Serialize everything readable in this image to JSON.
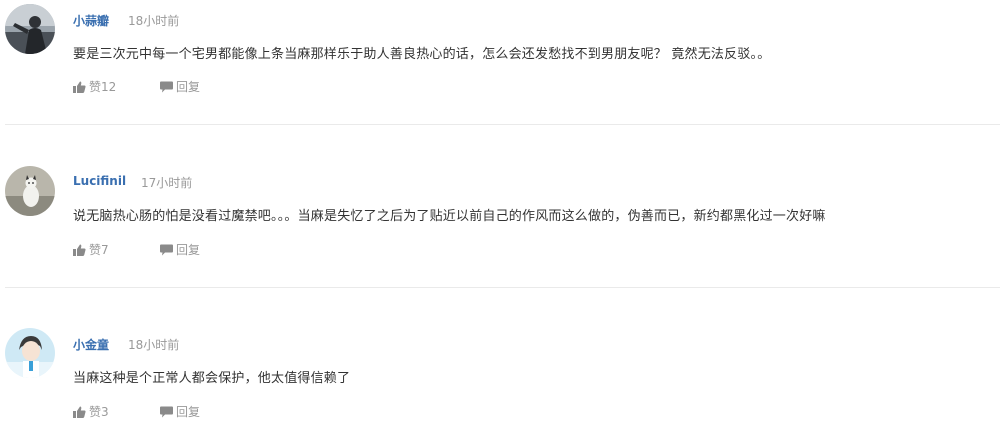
{
  "comments": [
    {
      "username": "小蒜瓣",
      "time": "18小时前",
      "text": "要是三次元中每一个宅男都能像上条当麻那样乐于助人善良热心的话，怎么会还发愁找不到男朋友呢？ 竟然无法反驳。。",
      "like_label": "赞12",
      "reply_label": "回复",
      "avatar_icon": "avatar-photo"
    },
    {
      "username": "Lucifinil",
      "time": "17小时前",
      "text": "说无脑热心肠的怕是没看过魔禁吧。。。当麻是失忆了之后为了贴近以前自己的作风而这么做的，伪善而已，新约都黑化过一次好嘛",
      "like_label": "赞7",
      "reply_label": "回复",
      "avatar_icon": "avatar-photo"
    },
    {
      "username": "小金童",
      "time": "18小时前",
      "text": "当麻这种是个正常人都会保护，他太值得信赖了",
      "like_label": "赞3",
      "reply_label": "回复",
      "avatar_icon": "avatar-photo"
    }
  ],
  "icons": {
    "like": "thumbs-up-icon",
    "reply": "speech-bubble-icon"
  },
  "colors": {
    "username": "#3a6fb0",
    "meta": "#999999",
    "text": "#333333",
    "divider": "#eaeaea"
  }
}
